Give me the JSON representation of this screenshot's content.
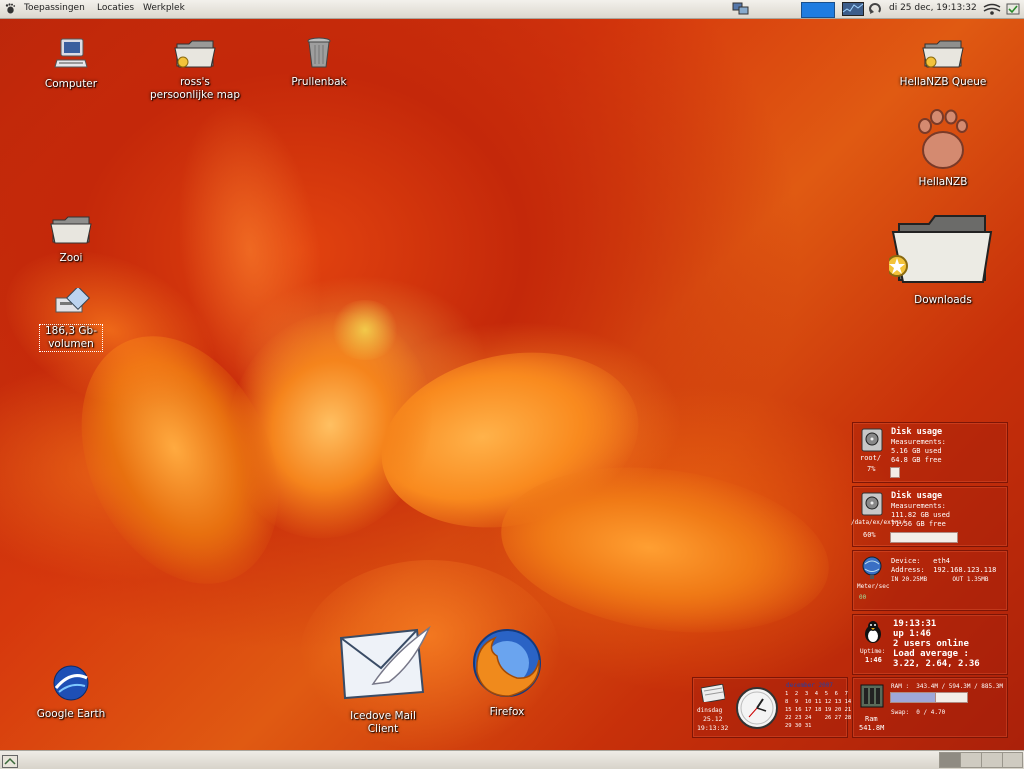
{
  "top_panel": {
    "menus": [
      "Toepassingen",
      "Locaties",
      "Werkplek"
    ],
    "clock": "di 25 dec, 19:13:32",
    "tray_icons": [
      "network-icon",
      "volume-meter-icon",
      "system-monitor-icon",
      "update-icon",
      "network-connection-icon",
      "status-icon"
    ]
  },
  "desktop_icons": {
    "computer": "Computer",
    "home": "ross's persoonlijke map",
    "trash": "Prullenbak",
    "zooi": "Zooi",
    "volume": "186,3 Gb-volumen",
    "hellanzb_queue": "HellaNZB Queue",
    "hellanzb": "HellaNZB",
    "downloads": "Downloads",
    "google_earth": "Google Earth",
    "icedove": "Icedove Mail Client",
    "firefox": "Firefox"
  },
  "widgets": {
    "disk1": {
      "title": "Disk usage",
      "sub": "Measurements:",
      "used": "5.16 GB used",
      "free": "64.8 GB free",
      "mount": "root/",
      "pct": "7%",
      "fraction": 0.07
    },
    "disk2": {
      "title": "Disk usage",
      "sub": "Measurements:",
      "used": "111.82 GB used",
      "free": "71.56 GB free",
      "mount": "/data/ex/extra/",
      "pct": "60%",
      "fraction": 0.6
    },
    "network": {
      "device": "Device:   eth4",
      "address": "Address:  192.168.123.118",
      "traffic": "IN 20.25MB       OUT 1.35MB",
      "label": "Meter/sec",
      "small": "00"
    },
    "uptime": {
      "time": "19:13:31",
      "up": "up 1:46",
      "users": "2 users online",
      "load_label": "Load average :",
      "load": "3.22, 2.64, 2.36",
      "icon_label": "Uptime:",
      "icon_value": "1:46"
    },
    "calendar": {
      "day_label": "dinsdag",
      "date": "25.12",
      "time": "19:13:32",
      "month": "december 2007",
      "rows": [
        "1  2  3  4  5  6  7",
        "8  9  10 11 12 13 14",
        "15 16 17 18 19 20 21",
        "22 23 24    26 27 28",
        "29 30 31"
      ]
    },
    "ram": {
      "ram_line": "RAM :  343.4M / 594.3M / 885.3M",
      "swap_line": "Swap:  0 / 4.70",
      "label": "Ram",
      "value": "541.8M",
      "fraction": 0.58
    }
  }
}
